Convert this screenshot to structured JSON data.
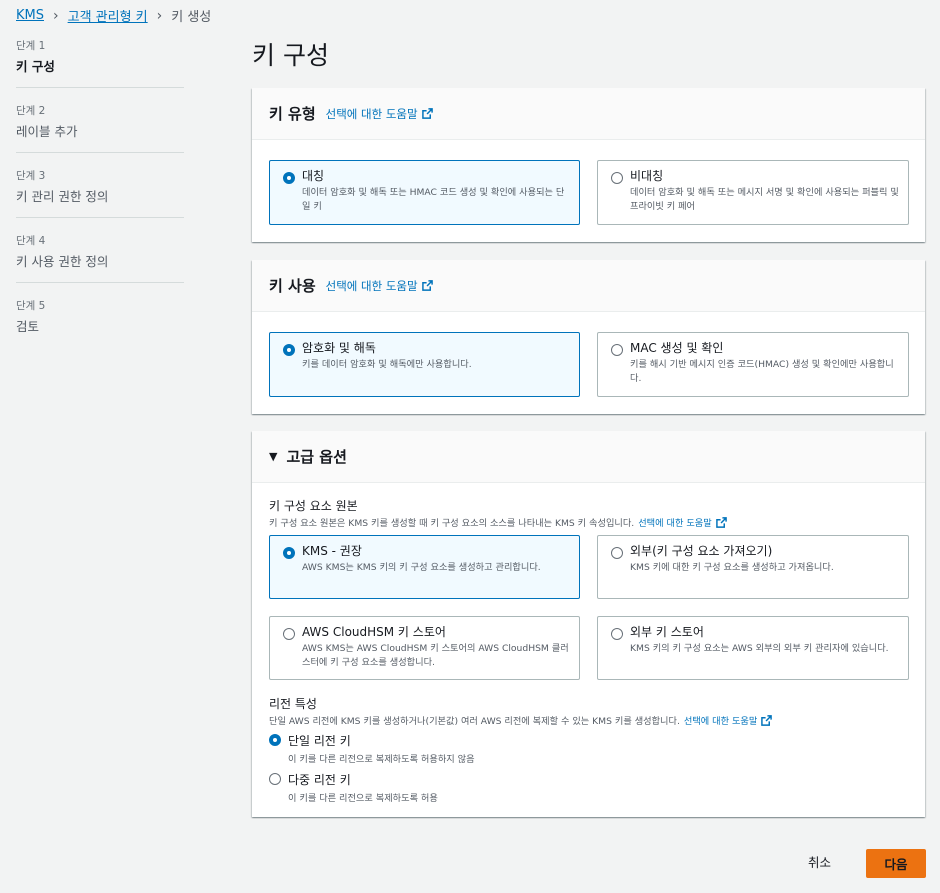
{
  "breadcrumb": {
    "kms": "KMS",
    "cmk": "고객 관리형 키",
    "current": "키 생성"
  },
  "steps": [
    {
      "num": "단계 1",
      "title": "키 구성"
    },
    {
      "num": "단계 2",
      "title": "레이블 추가"
    },
    {
      "num": "단계 3",
      "title": "키 관리 권한 정의"
    },
    {
      "num": "단계 4",
      "title": "키 사용 권한 정의"
    },
    {
      "num": "단계 5",
      "title": "검토"
    }
  ],
  "page_title": "키 구성",
  "key_type": {
    "title": "키 유형",
    "info": "선택에 대한 도움말",
    "options": [
      {
        "label": "대칭",
        "desc": "데이터 암호화 및 해독 또는 HMAC 코드 생성 및 확인에 사용되는 단일 키",
        "selected": true
      },
      {
        "label": "비대칭",
        "desc": "데이터 암호화 및 해독 또는 메시지 서명 및 확인에 사용되는 퍼블릭 및 프라이빗 키 페어",
        "selected": false
      }
    ]
  },
  "key_usage": {
    "title": "키 사용",
    "info": "선택에 대한 도움말",
    "options": [
      {
        "label": "암호화 및 해독",
        "desc": "키를 데이터 암호화 및 해독에만 사용합니다.",
        "selected": true
      },
      {
        "label": "MAC 생성 및 확인",
        "desc": "키를 해시 기반 메시지 인증 코드(HMAC) 생성 및 확인에만 사용합니다.",
        "selected": false
      }
    ]
  },
  "advanced": {
    "title": "고급 옵션",
    "origin_label": "키 구성 요소 원본",
    "origin_desc": "키 구성 요소 원본은 KMS 키를 생성할 때 키 구성 요소의 소스를 나타내는 KMS 키 속성입니다.",
    "origin_info": "선택에 대한 도움말",
    "origin_options": [
      {
        "label": "KMS - 권장",
        "desc": "AWS KMS는 KMS 키의 키 구성 요소를 생성하고 관리합니다.",
        "selected": true
      },
      {
        "label": "외부(키 구성 요소 가져오기)",
        "desc": "KMS 키에 대한 키 구성 요소를 생성하고 가져옵니다.",
        "selected": false
      },
      {
        "label": "AWS CloudHSM 키 스토어",
        "desc": "AWS KMS는 AWS CloudHSM 키 스토어의 AWS CloudHSM 클러스터에 키 구성 요소를 생성합니다.",
        "selected": false
      },
      {
        "label": "외부 키 스토어",
        "desc": "KMS 키의 키 구성 요소는 AWS 외부의 외부 키 관리자에 있습니다.",
        "selected": false
      }
    ],
    "region_label": "리전 특성",
    "region_desc": "단일 AWS 리전에 KMS 키를 생성하거나(기본값) 여러 AWS 리전에 복제할 수 있는 KMS 키를 생성합니다.",
    "region_info": "선택에 대한 도움말",
    "region_options": [
      {
        "label": "단일 리전 키",
        "desc": "이 키를 다른 리전으로 복제하도록 허용하지 않음",
        "selected": true
      },
      {
        "label": "다중 리전 키",
        "desc": "이 키를 다른 리전으로 복제하도록 허용",
        "selected": false
      }
    ]
  },
  "buttons": {
    "cancel": "취소",
    "next": "다음"
  },
  "colors": {
    "accent": "#0073bb",
    "primary_button": "#ec7211"
  }
}
